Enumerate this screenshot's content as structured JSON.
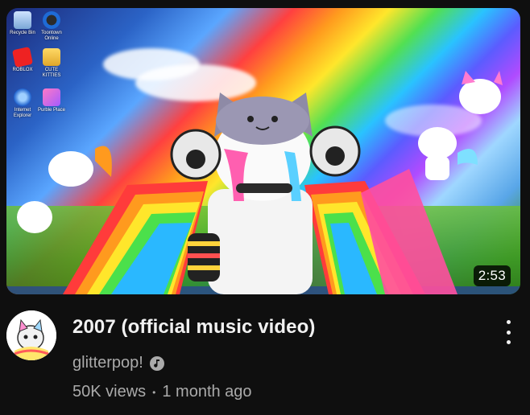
{
  "thumbnail": {
    "duration": "2:53",
    "desktop_icons": [
      {
        "label": "Recycle Bin",
        "icon": "recycle-bin-icon"
      },
      {
        "label": "Toontown Online",
        "icon": "toontown-icon"
      },
      {
        "label": "ROBLOX",
        "icon": "roblox-icon"
      },
      {
        "label": "CUTE KITTIES",
        "icon": "folder-icon"
      },
      {
        "label": "Internet Explorer",
        "icon": "internet-explorer-icon"
      },
      {
        "label": "Purble Place",
        "icon": "purble-place-icon"
      }
    ]
  },
  "video": {
    "title": "2007 (official music video)",
    "channel": "glitterpop!",
    "views": "50K views",
    "separator": "•",
    "age": "1 month ago"
  },
  "colors": {
    "background": "#0f0f0f",
    "title": "#f1f1f1",
    "secondary": "#aaaaaa"
  }
}
